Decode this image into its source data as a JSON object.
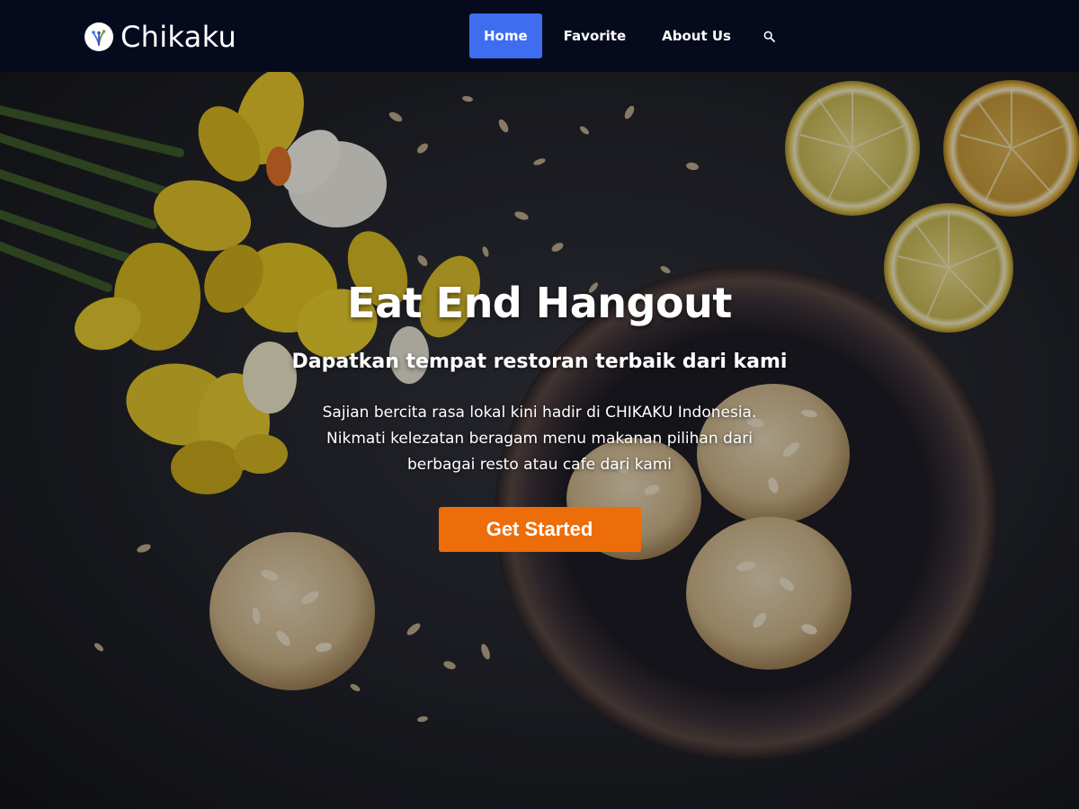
{
  "brand": {
    "name": "Chikaku",
    "logo_icon": "flower-logo-icon"
  },
  "nav": {
    "items": [
      {
        "label": "Home",
        "active": true
      },
      {
        "label": "Favorite",
        "active": false
      },
      {
        "label": "About Us",
        "active": false
      }
    ],
    "search_icon": "search-icon"
  },
  "hero": {
    "title": "Eat End Hangout",
    "subtitle": "Dapatkan tempat restoran terbaik dari kami",
    "description": "Sajian bercita rasa lokal kini hadir di CHIKAKU Indonesia. Nikmati kelezatan beragam menu makanan pilihan dari berbagai resto atau cafe dari kami",
    "cta_label": "Get Started",
    "background_icon": "food-hero-image"
  },
  "colors": {
    "navbar_bg": "#060a1d",
    "active_nav": "#3f6df0",
    "cta": "#ed6d0a",
    "text": "#ffffff"
  }
}
